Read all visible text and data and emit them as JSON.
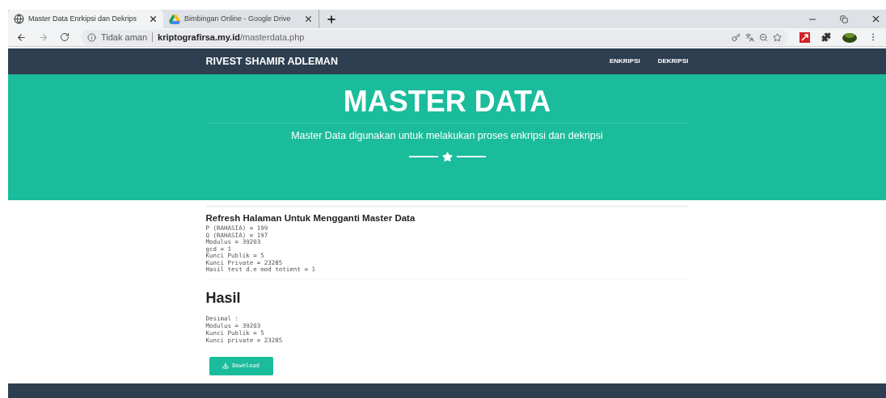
{
  "browser": {
    "tabs": [
      {
        "title": "Master Data Enrkipsi dan Dekrips",
        "selected": true,
        "kind": "globe"
      },
      {
        "title": "Bimbingan Online - Google Drive",
        "selected": false,
        "kind": "drive"
      }
    ],
    "security": "Tidak aman",
    "url_host": "kriptografirsa.my.id",
    "url_path": "/masterdata.php"
  },
  "navbar": {
    "brand": "RIVEST SHAMIR ADLEMAN",
    "links": [
      "ENKRIPSI",
      "DEKRIPSI"
    ]
  },
  "hero": {
    "title": "MASTER DATA",
    "subtitle": "Master Data digunakan untuk melakukan proses enkripsi dan dekripsi"
  },
  "master": {
    "heading": "Refresh Halaman Untuk Mengganti Master Data",
    "lines": [
      "P (RAHASIA) = 199",
      "Q (RAHASIA) = 197",
      "Modulus = 39203",
      "gcd = 1",
      "Kunci Publik = 5",
      "Kunci Private = 23285",
      "Hasil test d.e mod totient = 1"
    ]
  },
  "result": {
    "heading": "Hasil",
    "lines": [
      "Desimal :",
      "Modulus = 39203",
      "Kunci Publik = 5",
      "Kunci private = 23285"
    ],
    "button": "Download"
  }
}
